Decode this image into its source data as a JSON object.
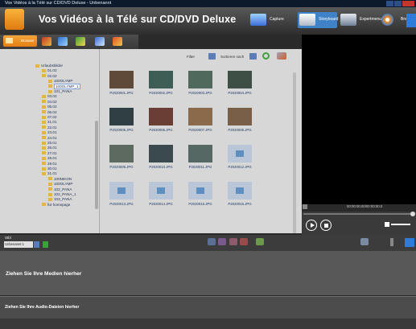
{
  "window": {
    "title": "Vos Vidéos à la Télé sur CD/DVD Deluxe - Unbenannt"
  },
  "header": {
    "title": "Vos Vidéos à la Télé sur CD/DVD Deluxe",
    "modes": [
      {
        "label": "Capture"
      },
      {
        "label": "Storyboard"
      },
      {
        "label": "Expertmenu"
      },
      {
        "label": "Brennen"
      }
    ]
  },
  "browser": {
    "active_tab": "Browser",
    "tree": [
      {
        "label": "Urlaubsbilder",
        "indent": 0
      },
      {
        "label": "01.02",
        "indent": 1
      },
      {
        "label": "02.02",
        "indent": 1
      },
      {
        "label": "100OLYMP",
        "indent": 2
      },
      {
        "label": "100OLYMP_1",
        "indent": 2,
        "selected": true
      },
      {
        "label": "101_PANA",
        "indent": 2
      },
      {
        "label": "03.02",
        "indent": 1
      },
      {
        "label": "04.02",
        "indent": 1
      },
      {
        "label": "05.02",
        "indent": 1
      },
      {
        "label": "06.02",
        "indent": 1
      },
      {
        "label": "07.02",
        "indent": 1
      },
      {
        "label": "21.01",
        "indent": 1
      },
      {
        "label": "22.01",
        "indent": 1
      },
      {
        "label": "23.01",
        "indent": 1
      },
      {
        "label": "24.01",
        "indent": 1
      },
      {
        "label": "25.01",
        "indent": 1
      },
      {
        "label": "26.01",
        "indent": 1
      },
      {
        "label": "27.01",
        "indent": 1
      },
      {
        "label": "28.01",
        "indent": 1
      },
      {
        "label": "29.01",
        "indent": 1
      },
      {
        "label": "30.01",
        "indent": 1
      },
      {
        "label": "31.01",
        "indent": 1
      },
      {
        "label": "100NIKON",
        "indent": 2
      },
      {
        "label": "100OLYMP",
        "indent": 2
      },
      {
        "label": "102_PANA",
        "indent": 2
      },
      {
        "label": "102_PANA_1",
        "indent": 2
      },
      {
        "label": "103_PANA",
        "indent": 2
      },
      {
        "label": "für homepage",
        "indent": 1
      }
    ],
    "filter_label": "Filter",
    "sort_label": "Sortieren nach",
    "thumbnails": [
      {
        "name": "P2020001.JPG",
        "color": "#5f4a3a"
      },
      {
        "name": "P2020002.JPG",
        "color": "#3d5d55"
      },
      {
        "name": "P2020003.JPG",
        "color": "#4f6a5c"
      },
      {
        "name": "P2020004.JPG",
        "color": "#3e5046"
      },
      {
        "name": "P2020005.JPG",
        "color": "#2f3f44"
      },
      {
        "name": "P2020006.JPG",
        "color": "#6a3e34"
      },
      {
        "name": "P2020007.JPG",
        "color": "#8a6a4a"
      },
      {
        "name": "P2020008.JPG",
        "color": "#7a5f48"
      },
      {
        "name": "P2020009.JPG",
        "color": "#5d6a60"
      },
      {
        "name": "P2020010.JPG",
        "color": "#3a4a4f"
      },
      {
        "name": "P2020011.JPG",
        "color": "#556863"
      },
      {
        "name": "P2020012.JPG",
        "placeholder": true
      },
      {
        "name": "P2020013.JPG",
        "placeholder": true
      },
      {
        "name": "P2020014.JPG",
        "placeholder": true
      },
      {
        "name": "P2020015.JPG",
        "placeholder": true
      },
      {
        "name": "P2020016.JPG",
        "placeholder": true
      }
    ]
  },
  "preview": {
    "timecode": "00:00:00.00/00:00:00.0"
  },
  "storyboard": {
    "label": "Stbl",
    "selected": "Unbenannt 1",
    "drop_media": "Ziehen Sie Ihre Medien hierher",
    "drop_audio": "Ziehen Sie Ihre Audio-Dateien hierher"
  }
}
